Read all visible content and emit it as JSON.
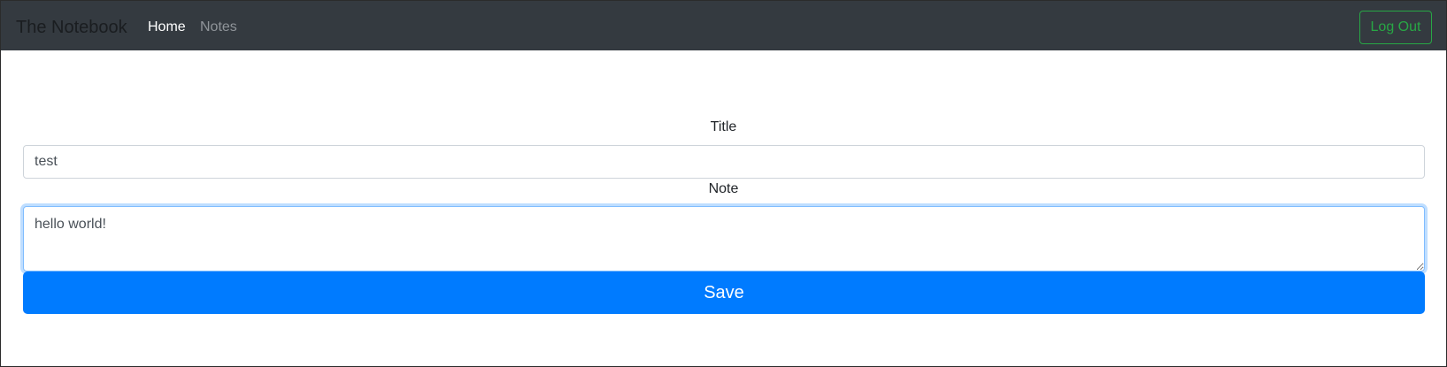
{
  "navbar": {
    "brand": "The Notebook",
    "links": [
      {
        "label": "Home",
        "active": true
      },
      {
        "label": "Notes",
        "active": false
      }
    ],
    "logout_label": "Log Out"
  },
  "form": {
    "title_label": "Title",
    "title_value": "test",
    "note_label": "Note",
    "note_value": "hello world!",
    "save_label": "Save"
  },
  "colors": {
    "navbar_bg": "#343a40",
    "logout_outline": "#28a745",
    "primary": "#007bff"
  }
}
